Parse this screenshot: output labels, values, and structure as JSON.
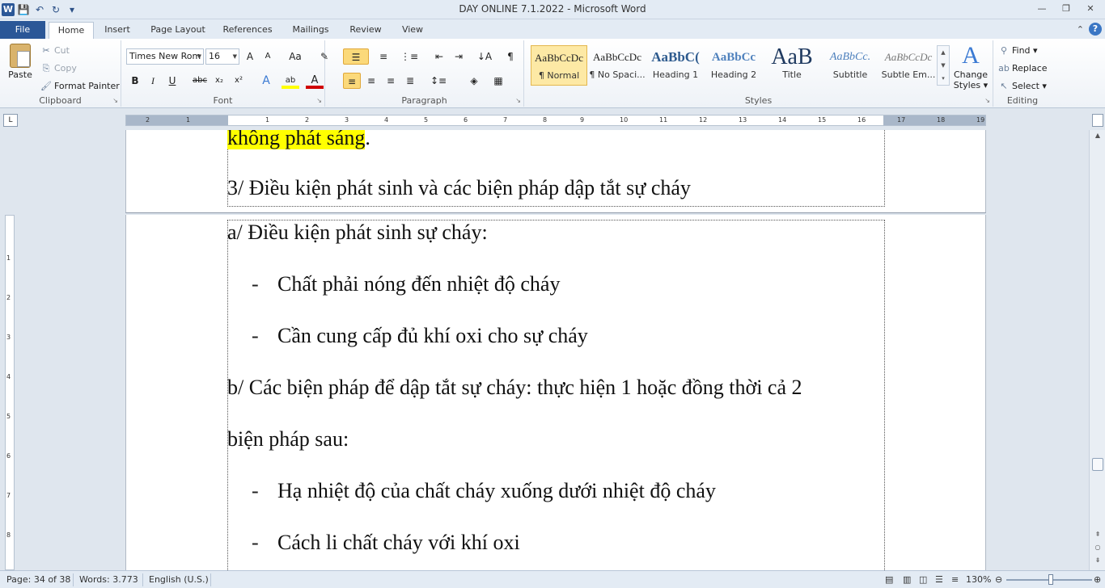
{
  "window": {
    "title": "DAY ONLINE 7.1.2022 - Microsoft Word",
    "app_icon": "W",
    "controls": {
      "minimize": "—",
      "restore": "❐",
      "close": "✕"
    }
  },
  "quick_access": {
    "save": "💾",
    "undo": "↶",
    "redo": "↻",
    "customize": "▾"
  },
  "tabs": [
    {
      "label": "File"
    },
    {
      "label": "Home"
    },
    {
      "label": "Insert"
    },
    {
      "label": "Page Layout"
    },
    {
      "label": "References"
    },
    {
      "label": "Mailings"
    },
    {
      "label": "Review"
    },
    {
      "label": "View"
    }
  ],
  "ribbon": {
    "clipboard": {
      "group_label": "Clipboard",
      "paste": "Paste",
      "cut": "Cut",
      "copy": "Copy",
      "format_painter": "Format Painter"
    },
    "font": {
      "group_label": "Font",
      "font_name": "Times New Rom",
      "font_size": "16",
      "grow": "A",
      "shrink": "A",
      "change_case": "Aa",
      "clear": "✎",
      "bold": "B",
      "italic": "I",
      "underline": "U",
      "strike": "abc",
      "subscript": "x₂",
      "superscript": "x²",
      "effects": "A",
      "highlight": "ab",
      "font_color": "A"
    },
    "paragraph": {
      "group_label": "Paragraph",
      "pilcrow": "¶",
      "sort": "↓A"
    },
    "styles": {
      "group_label": "Styles",
      "tiles": [
        {
          "sample": "AaBbCcDc",
          "name": "¶ Normal"
        },
        {
          "sample": "AaBbCcDc",
          "name": "¶ No Spaci..."
        },
        {
          "sample": "AaBbC(",
          "name": "Heading 1"
        },
        {
          "sample": "AaBbCc",
          "name": "Heading 2"
        },
        {
          "sample": "AaB",
          "name": "Title"
        },
        {
          "sample": "AaBbCc.",
          "name": "Subtitle"
        },
        {
          "sample": "AaBbCcDc",
          "name": "Subtle Em..."
        }
      ],
      "change_styles_line1": "Change",
      "change_styles_line2": "Styles ▾"
    },
    "editing": {
      "group_label": "Editing",
      "find": "Find",
      "replace": "Replace",
      "select": "Select"
    }
  },
  "ruler_numbers": [
    "2",
    "1",
    "1",
    "2",
    "3",
    "4",
    "5",
    "6",
    "7",
    "8",
    "9",
    "10",
    "11",
    "12",
    "13",
    "14",
    "15",
    "16",
    "17",
    "18",
    "19"
  ],
  "vruler_numbers": [
    "1",
    "2",
    "3",
    "4",
    "5",
    "6",
    "7",
    "8"
  ],
  "document": {
    "page_a": {
      "line1_highlighted": "không phát sáng",
      "line1_tail": ".",
      "line2": "3/ Điều kiện phát sinh và các biện pháp dập tắt sự cháy"
    },
    "page_b": {
      "p1": "a/ Điều kiện phát sinh sự cháy:",
      "b1": "Chất phải nóng đến nhiệt độ cháy",
      "b2": "Cần cung cấp đủ khí oxi cho sự cháy",
      "p2": "b/ Các biện pháp để dập tắt sự cháy: thực hiện 1 hoặc đồng thời cả 2",
      "p3": "biện pháp sau:",
      "b3": "Hạ nhiệt độ của chất cháy xuống dưới nhiệt độ cháy",
      "b4": "Cách li chất cháy với khí oxi",
      "dash": "-"
    }
  },
  "status": {
    "page": "Page: 34 of 38",
    "words": "Words: 3.773",
    "language": "English (U.S.)",
    "zoom": "130%"
  },
  "colors": {
    "file_tab": "#2b5797",
    "highlight": "#ffff00",
    "selected_style": "#fde9a5"
  }
}
